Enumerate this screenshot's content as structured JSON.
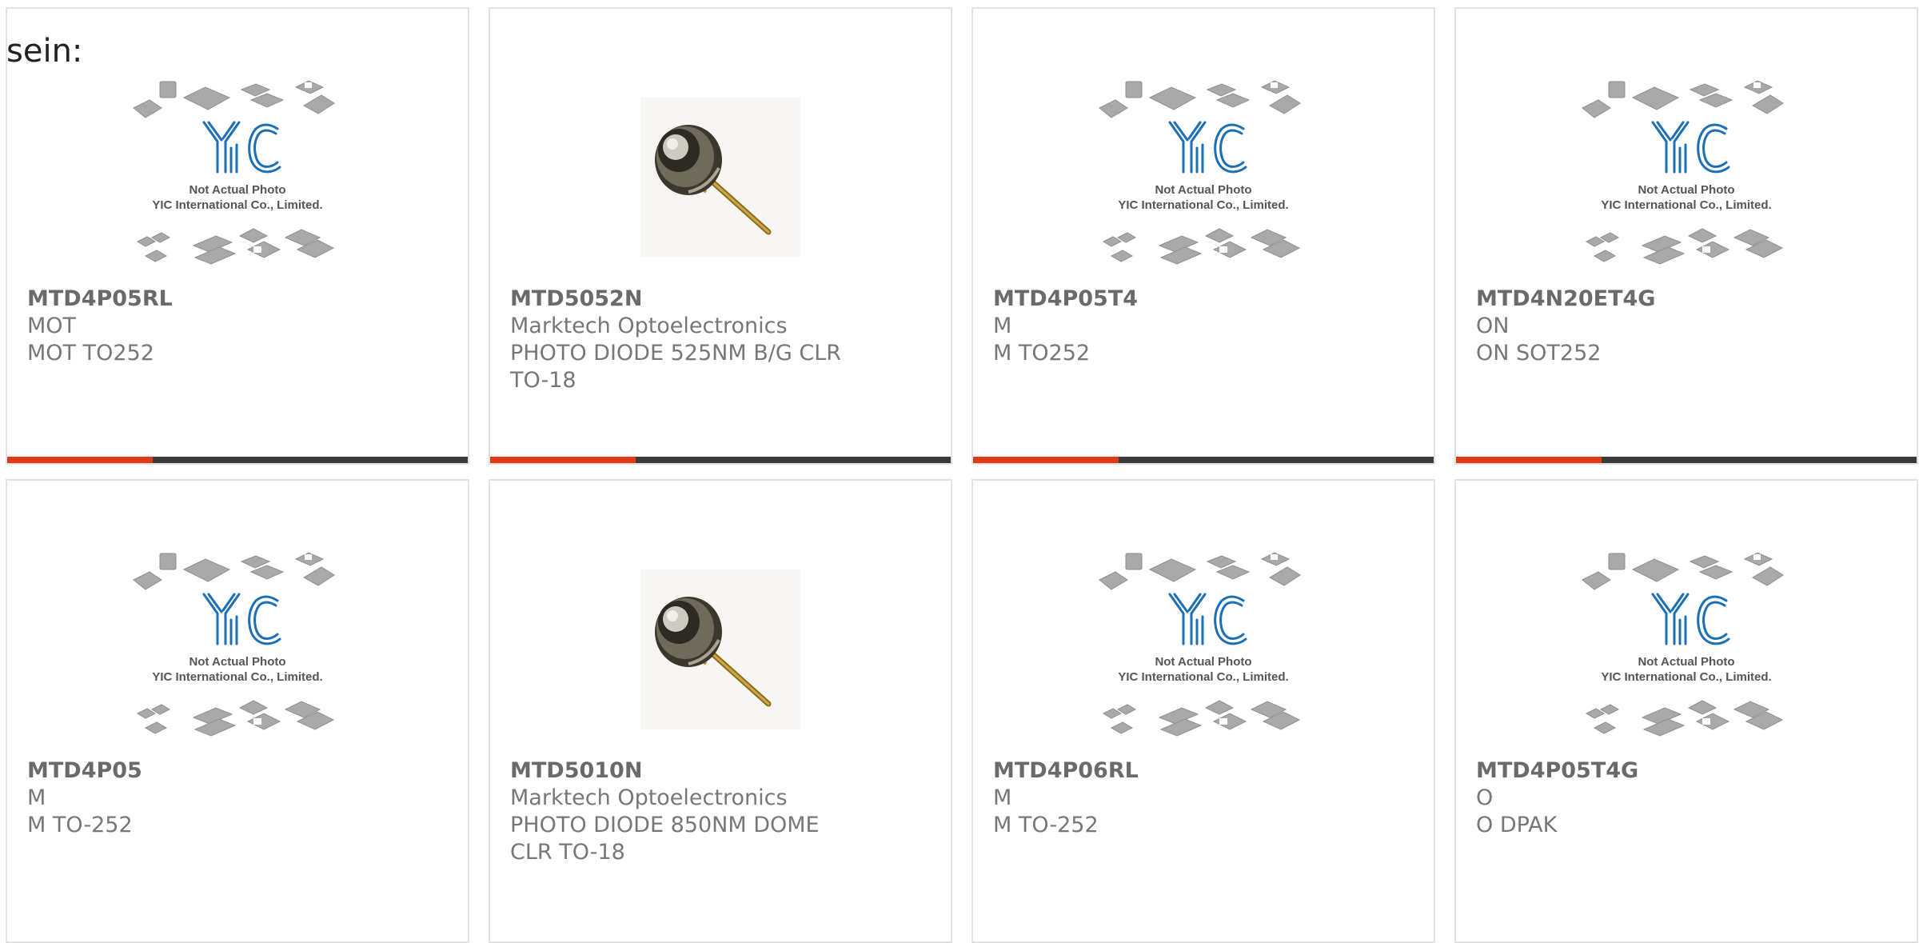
{
  "page_label": "sein:",
  "placeholder_caption": {
    "line1": "Not Actual Photo",
    "line2": "YIC International Co., Limited."
  },
  "colors": {
    "accent": "#e33a12",
    "bar": "#3b3b3b",
    "text": "#777777",
    "logo_blue": "#1a6fb5"
  },
  "cards": [
    {
      "part": "MTD4P05RL",
      "maker": "MOT",
      "desc": "MOT TO252",
      "image": "yic-placeholder",
      "bar": true
    },
    {
      "part": "MTD5052N",
      "maker": "Marktech Optoelectronics",
      "desc": "PHOTO DIODE 525NM B/G CLR TO-18",
      "image": "photodiode-photo",
      "bar": true
    },
    {
      "part": "MTD4P05T4",
      "maker": "M",
      "desc": "M TO252",
      "image": "yic-placeholder",
      "bar": true
    },
    {
      "part": "MTD4N20ET4G",
      "maker": "ON",
      "desc": "ON SOT252",
      "image": "yic-placeholder",
      "bar": true
    },
    {
      "part": "MTD4P05",
      "maker": "M",
      "desc": "M TO-252",
      "image": "yic-placeholder",
      "bar": false
    },
    {
      "part": "MTD5010N",
      "maker": "Marktech Optoelectronics",
      "desc": "PHOTO DIODE 850NM DOME CLR TO-18",
      "image": "photodiode-photo",
      "bar": false
    },
    {
      "part": "MTD4P06RL",
      "maker": "M",
      "desc": "M TO-252",
      "image": "yic-placeholder",
      "bar": false
    },
    {
      "part": "MTD4P05T4G",
      "maker": "O",
      "desc": "O DPAK",
      "image": "yic-placeholder",
      "bar": false
    }
  ]
}
